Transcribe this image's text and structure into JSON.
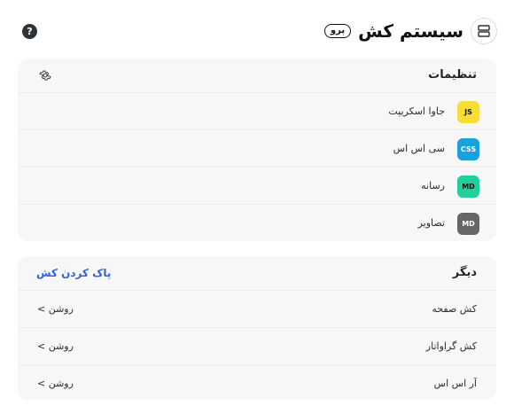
{
  "header": {
    "title": "سیستم کش",
    "badge": "پرو",
    "help_icon": "question-circle-icon",
    "help_symbol": "?",
    "app_icon": "server-stack-icon"
  },
  "settings": {
    "title": "تنظیمات",
    "gear_icon": "gear-icon",
    "items": [
      {
        "badge": "JS",
        "label": "جاوا اسکریپت",
        "badge_bg": "#f6dd38",
        "badge_fg": "#111111"
      },
      {
        "badge": "CSS",
        "label": "سی اس اس",
        "badge_bg": "#1c9fe0",
        "badge_fg": "#ffffff"
      },
      {
        "badge": "MD",
        "label": "رسانه",
        "badge_bg": "#21cf9d",
        "badge_fg": "#111111"
      },
      {
        "badge": "MD",
        "label": "تصاویر",
        "badge_bg": "#666666",
        "badge_fg": "#ffffff"
      }
    ]
  },
  "other": {
    "title": "دیگر",
    "clear_action": "پاک کردن کش",
    "rows": [
      {
        "label": "کش صفحه",
        "status": "روشن >"
      },
      {
        "label": "کش گراواتار",
        "status": "روشن >"
      },
      {
        "label": "آر اس اس",
        "status": "روشن >"
      }
    ]
  },
  "colors": {
    "card_bg": "#f7f7f8",
    "accent": "#2e63d9"
  }
}
